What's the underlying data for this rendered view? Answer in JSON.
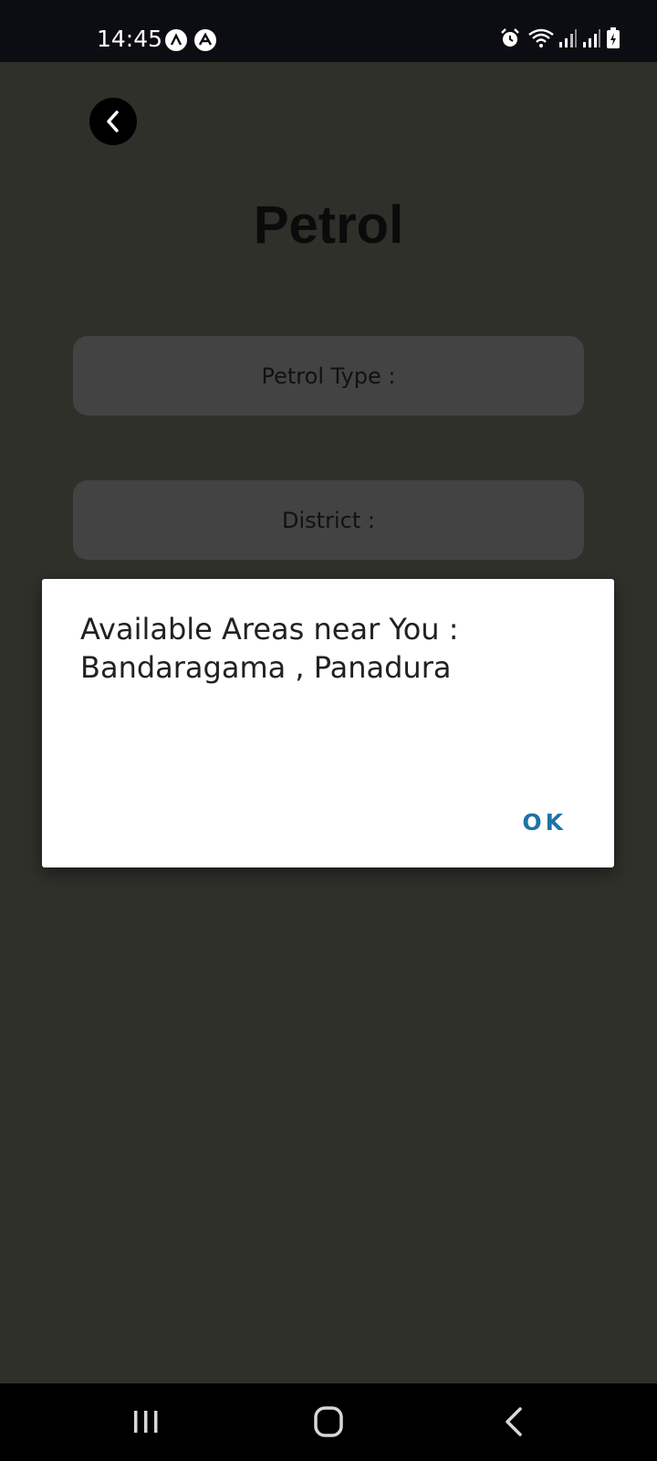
{
  "status_bar": {
    "time": "14:45",
    "icons": [
      "app-notification-icon",
      "app-notification-icon",
      "alarm-icon",
      "wifi-icon",
      "signal-icon",
      "signal-icon",
      "battery-charging-icon"
    ]
  },
  "screen": {
    "title": "Petrol",
    "fields": {
      "petrol_type_label": "Petrol Type :",
      "district_label": "District :"
    },
    "background_color": "#30302a"
  },
  "dialog": {
    "message_line1": "Available Areas near You :",
    "message_line2": "Bandaragama , Panadura",
    "ok_label": "OK",
    "ok_color": "#1f73a6"
  },
  "nav_bar": {
    "buttons": [
      "recents-icon",
      "home-icon",
      "back-icon"
    ]
  }
}
